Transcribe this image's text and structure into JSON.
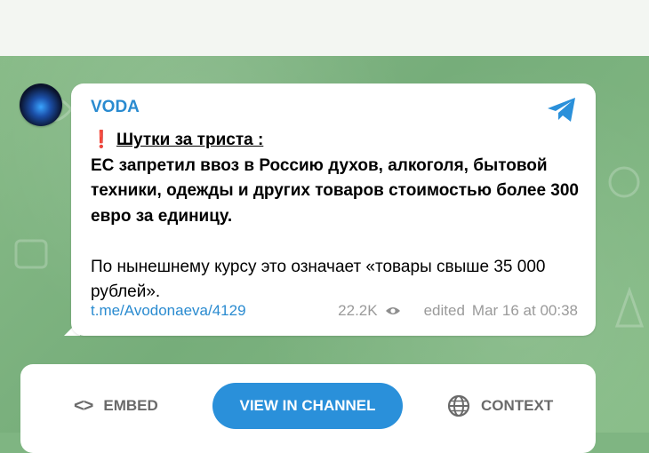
{
  "post": {
    "author": "VODA",
    "headline_mark": "❗️",
    "headline": "Шутки за триста :",
    "body_bold": "ЕС запретил ввоз в Россию духов, алкоголя, бытовой техники, одежды и других товаров стоимостью более 300 евро за единицу.",
    "body_regular": "По нынешнему курсу это означает «товары свыше 35 000 рублей».",
    "link": "t.me/Avodonaeva/4129",
    "views": "22.2K",
    "edited": "edited",
    "date": "Mar 16 at 00:38"
  },
  "actions": {
    "embed_label": "EMBED",
    "view_label": "VIEW IN CHANNEL",
    "context_label": "CONTEXT"
  },
  "icons": [
    "avatar",
    "telegram-icon",
    "eye-icon",
    "code-icon",
    "globe-icon"
  ],
  "colors": {
    "accent": "#2a8bd0",
    "button": "#2a90da",
    "background": "#7fb582"
  }
}
